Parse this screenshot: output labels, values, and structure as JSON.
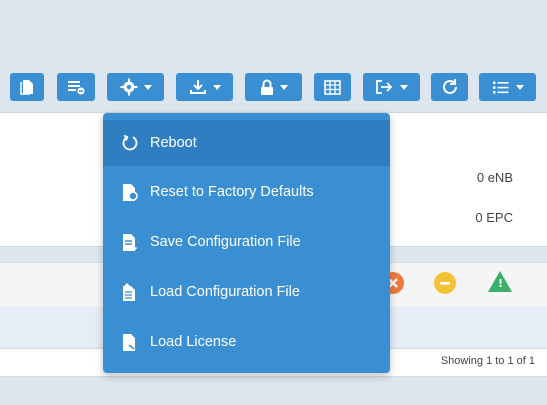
{
  "toolbar": {
    "buttons": [
      {
        "name": "copy-button",
        "icon": "document-icon",
        "dropdown": false
      },
      {
        "name": "list-remove-button",
        "icon": "list-remove-icon",
        "dropdown": false
      },
      {
        "name": "settings-dropdown-button",
        "icon": "gear-icon",
        "dropdown": true
      },
      {
        "name": "download-dropdown-button",
        "icon": "download-icon",
        "dropdown": true
      },
      {
        "name": "lock-dropdown-button",
        "icon": "lock-icon",
        "dropdown": true
      },
      {
        "name": "table-button",
        "icon": "table-icon",
        "dropdown": false
      },
      {
        "name": "export-dropdown-button",
        "icon": "export-icon",
        "dropdown": true
      },
      {
        "name": "refresh-button",
        "icon": "refresh-icon",
        "dropdown": false
      },
      {
        "name": "list-dropdown-button",
        "icon": "list-icon",
        "dropdown": true
      }
    ],
    "accent": "#3a8fd2"
  },
  "stats": {
    "enb": "0 eNB",
    "epc": "0 EPC"
  },
  "alerts": {
    "icons": [
      "error-icon",
      "minus-circle-icon",
      "warning-icon"
    ],
    "colors": {
      "error": "#f07a3a",
      "minus": "#f5c233",
      "warning": "#3bb06a"
    }
  },
  "footer": {
    "showing": "Showing 1 to 1 of 1"
  },
  "menu": {
    "items": [
      {
        "label": "Reboot",
        "icon": "reboot-icon",
        "active": true
      },
      {
        "label": "Reset to Factory Defaults",
        "icon": "reset-file-icon",
        "active": false
      },
      {
        "label": "Save Configuration File",
        "icon": "save-file-icon",
        "active": false
      },
      {
        "label": "Load Configuration File",
        "icon": "load-file-icon",
        "active": false
      },
      {
        "label": "Load License",
        "icon": "license-file-icon",
        "active": false
      }
    ]
  }
}
